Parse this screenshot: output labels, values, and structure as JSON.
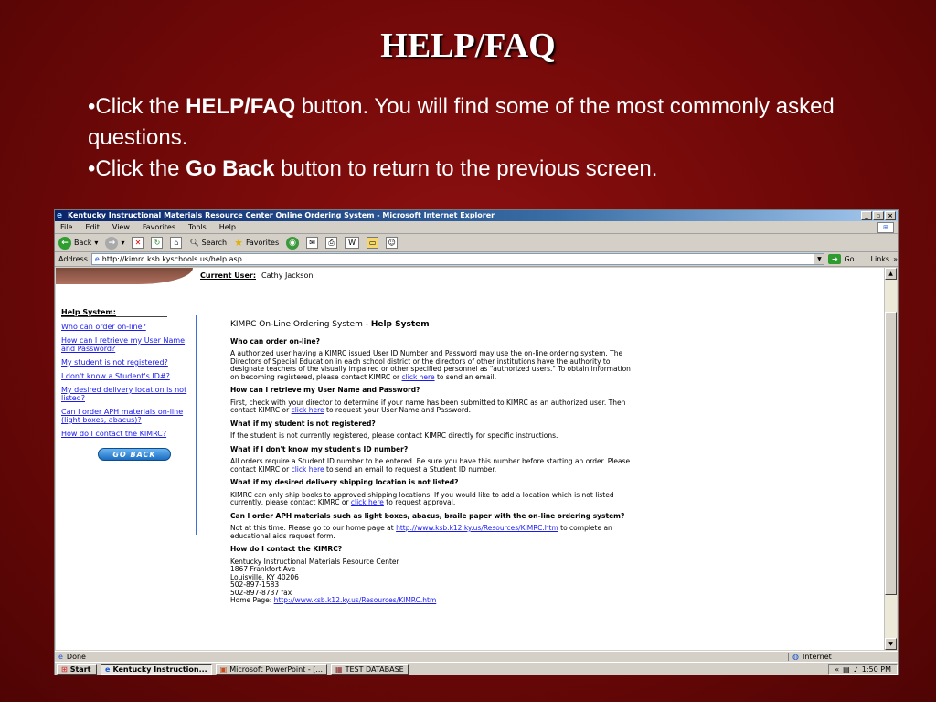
{
  "slide": {
    "title": "HELP/FAQ",
    "bullets": [
      {
        "prefix": "•Click the ",
        "bold": "HELP/FAQ",
        "suffix": " button. You will find some of the most commonly asked questions."
      },
      {
        "prefix": "•Click the ",
        "bold": "Go Back",
        "suffix": " button to return to the previous screen."
      }
    ]
  },
  "window": {
    "title": "Kentucky Instructional Materials Resource Center Online Ordering System - Microsoft Internet Explorer",
    "menu": [
      "File",
      "Edit",
      "View",
      "Favorites",
      "Tools",
      "Help"
    ],
    "toolbar": {
      "back": "Back",
      "search": "Search",
      "favorites": "Favorites"
    },
    "address_label": "Address",
    "address_value": "http://kimrc.ksb.kyschools.us/help.asp",
    "go_label": "Go",
    "links_label": "Links"
  },
  "page": {
    "current_user_label": "Current User:",
    "current_user_value": "Cathy Jackson",
    "sidebar_heading": "Help System:",
    "sidebar_links": [
      "Who can order on-line?",
      "How can I retrieve my User Name and Password?",
      "My student is not registered?",
      "I don't know a Student's ID#?",
      "My desired delivery location is not listed?",
      "Can I order APH materials on-line (light boxes, abacus)?",
      "How do I contact the KIMRC?"
    ],
    "go_back_label": "GO BACK",
    "header_prefix": "KIMRC On-Line Ordering System - ",
    "header_bold": "Help System",
    "faq": [
      {
        "q": "Who can order on-line?",
        "a": "A authorized user having a KIMRC issued User ID Number and Password may use the on-line ordering system. The Directors of Special Education in each school district or the directors of other institutions have the authority to designate teachers of the visually impaired or other specified personnel as \"authorized users.\" To obtain information on becoming registered, please contact KIMRC or ",
        "link": "click here",
        "after": " to send an email."
      },
      {
        "q": "How can I retrieve my User Name and Password?",
        "a": "First, check with your director to determine if your name has been submitted to KIMRC as an authorized user. Then contact KIMRC or ",
        "link": "click here",
        "after": " to request your User Name and Password."
      },
      {
        "q": "What if my student is not registered?",
        "a": "If the student is not currently registered, please contact KIMRC directly for specific instructions.",
        "link": "",
        "after": ""
      },
      {
        "q": "What if I don't know my student's ID number?",
        "a": "All orders require a Student ID number to be entered. Be sure you have this number before starting an order. Please contact KIMRC or ",
        "link": "click here",
        "after": " to send an email to request a Student ID number."
      },
      {
        "q": "What if my desired delivery shipping location is not listed?",
        "a": "KIMRC can only ship books to approved shipping locations. If you would like to add a location which is not listed currently, please contact KIMRC or ",
        "link": "click here",
        "after": " to request approval."
      },
      {
        "q": "Can I order APH materials such as light boxes, abacus, braile paper with the on-line ordering system?",
        "a": "Not at this time. Please go to our home page at ",
        "link": "http://www.ksb.k12.ky.us/Resources/KIMRC.htm",
        "after": " to complete an educational aids request form."
      }
    ],
    "contact": {
      "q": "How do I contact the KIMRC?",
      "lines": [
        "Kentucky Instructional Materials Resource Center",
        "1867 Frankfort Ave",
        "Louisville, KY 40206",
        "502-897-1583",
        "502-897-8737 fax"
      ],
      "home_label": "Home Page: ",
      "home_link": "http://www.ksb.k12.ky.us/Resources/KIMRC.htm"
    }
  },
  "status": {
    "left": "Done",
    "zone": "Internet"
  },
  "taskbar": {
    "start": "Start",
    "tasks": [
      "Kentucky Instruction...",
      "Microsoft PowerPoint - [...",
      "TEST DATABASE"
    ],
    "clock": "1:50 PM"
  }
}
